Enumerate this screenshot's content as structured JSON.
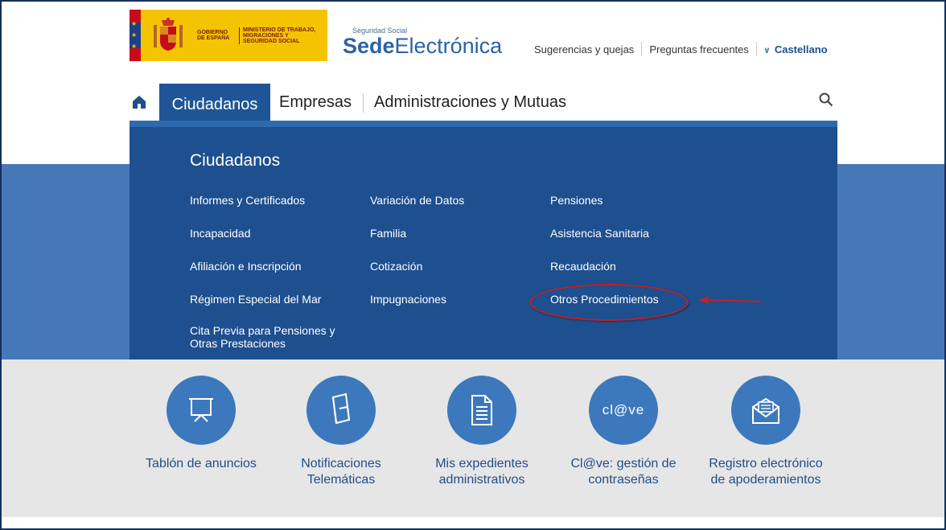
{
  "header": {
    "gov_label": "GOBIERNO DE ESPAÑA",
    "ministry_label": "MINISTERIO DE TRABAJO, MIGRACIONES Y SEGURIDAD SOCIAL",
    "site_small": "Seguridad Social",
    "site_bold": "Sede",
    "site_light": "Electrónica",
    "links": [
      "Sugerencias y quejas",
      "Preguntas frecuentes"
    ],
    "language": "Castellano"
  },
  "nav": {
    "active_tab": "Ciudadanos",
    "tabs": [
      "Empresas",
      "Administraciones y Mutuas"
    ]
  },
  "mega_menu": {
    "title": "Ciudadanos",
    "col1": [
      "Informes y Certificados",
      "Incapacidad",
      "Afiliación e Inscripción",
      "Régimen Especial del Mar",
      "Cita Previa para Pensiones y",
      "Otras Prestaciones"
    ],
    "col2": [
      "Variación de Datos",
      "Familia",
      "Cotización",
      "Impugnaciones"
    ],
    "col3": [
      "Pensiones",
      "Asistencia Sanitaria",
      "Recaudación",
      "Otros Procedimientos"
    ]
  },
  "services": [
    {
      "icon": "noticeboard-icon",
      "line1": "Tablón de anuncios",
      "line2": ""
    },
    {
      "icon": "notification-icon",
      "line1": "Notificaciones",
      "line2": "Telemáticas"
    },
    {
      "icon": "document-icon",
      "line1": "Mis expedientes",
      "line2": "administrativos"
    },
    {
      "icon": "clave-icon",
      "icon_text": "cl@ve",
      "line1": "Cl@ve: gestión de",
      "line2": "contraseñas"
    },
    {
      "icon": "envelope-icon",
      "line1": "Registro electrónico",
      "line2": "de apoderamientos"
    }
  ],
  "colors": {
    "gov_yellow": "#f5c400",
    "brand_blue": "#2a63a8",
    "menu_blue": "#1e4f8f",
    "band_blue": "#4678b8",
    "service_circle": "#3d78bc",
    "annotation_red": "#c32020"
  }
}
